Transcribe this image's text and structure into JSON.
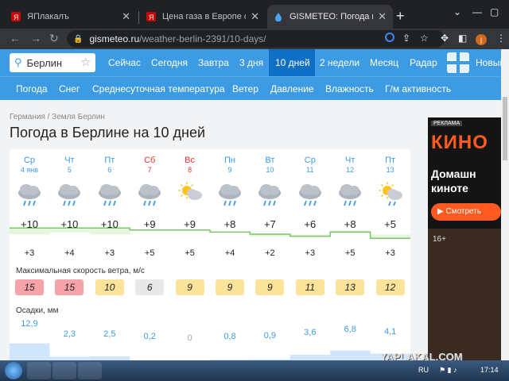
{
  "browser": {
    "tabs": [
      {
        "title": "ЯПлакалъ",
        "active": false
      },
      {
        "title": "Цена газа в Европе опустилась",
        "active": false
      },
      {
        "title": "GISMETEO: Погода в Берлине на",
        "active": true
      }
    ],
    "url_host": "gismeteo.ru",
    "url_path": "/weather-berlin-2391/10-days/",
    "avatar_letter": "j"
  },
  "site": {
    "search_value": "Берлин",
    "nav": [
      "Сейчас",
      "Сегодня",
      "Завтра",
      "3 дня",
      "10 дней",
      "2 недели",
      "Месяц",
      "Радар",
      "Новый"
    ],
    "active_nav": "10 дней",
    "subnav": [
      "Погода",
      "Снег",
      "Среднесуточная температура",
      "Ветер",
      "Давление",
      "Влажность",
      "Г/м активность"
    ],
    "breadcrumb": "Германия / Земля Берлин",
    "title": "Погода в Берлине на 10 дней",
    "wind_title": "Максимальная скорость ветра, м/с",
    "precip_title": "Осадки, мм",
    "days": [
      {
        "name": "Ср",
        "date": "4 янв",
        "weekend": false,
        "icon": "cloud-rain-icon",
        "tmax": "+10",
        "tmin": "+3",
        "wind": "15",
        "windcolor": "#f5a3a8",
        "precip": "12,9",
        "precip_level": 0.9
      },
      {
        "name": "Чт",
        "date": "5",
        "weekend": false,
        "icon": "cloud-rain-icon",
        "tmax": "+10",
        "tmin": "+4",
        "wind": "15",
        "windcolor": "#f5a3a8",
        "precip": "2,3",
        "precip_level": 0.25
      },
      {
        "name": "Пт",
        "date": "6",
        "weekend": false,
        "icon": "cloud-rain-icon",
        "tmax": "+10",
        "tmin": "+3",
        "wind": "10",
        "windcolor": "#fbe39a",
        "precip": "2,5",
        "precip_level": 0.27
      },
      {
        "name": "Сб",
        "date": "7",
        "weekend": true,
        "icon": "cloud-rain-icon",
        "tmax": "+9",
        "tmin": "+5",
        "wind": "6",
        "windcolor": "#e8e8e8",
        "precip": "0,2",
        "precip_level": 0.08
      },
      {
        "name": "Вс",
        "date": "8",
        "weekend": true,
        "icon": "sun-cloud-icon",
        "tmax": "+9",
        "tmin": "+5",
        "wind": "9",
        "windcolor": "#fbe39a",
        "precip": "0",
        "precip_level": 0
      },
      {
        "name": "Пн",
        "date": "9",
        "weekend": false,
        "icon": "cloud-rain-icon",
        "tmax": "+8",
        "tmin": "+4",
        "wind": "9",
        "windcolor": "#fbe39a",
        "precip": "0,8",
        "precip_level": 0.12
      },
      {
        "name": "Вт",
        "date": "10",
        "weekend": false,
        "icon": "cloud-rain-icon",
        "tmax": "+7",
        "tmin": "+2",
        "wind": "9",
        "windcolor": "#fbe39a",
        "precip": "0,9",
        "precip_level": 0.13
      },
      {
        "name": "Ср",
        "date": "11",
        "weekend": false,
        "icon": "cloud-rain-icon",
        "tmax": "+6",
        "tmin": "+3",
        "wind": "11",
        "windcolor": "#fbe39a",
        "precip": "3,6",
        "precip_level": 0.35
      },
      {
        "name": "Чт",
        "date": "12",
        "weekend": false,
        "icon": "cloud-rain-icon",
        "tmax": "+8",
        "tmin": "+5",
        "wind": "13",
        "windcolor": "#fbe39a",
        "precip": "6,8",
        "precip_level": 0.55
      },
      {
        "name": "Пт",
        "date": "13",
        "weekend": false,
        "icon": "sun-cloud-rain-icon",
        "tmax": "+5",
        "tmin": "+3",
        "wind": "12",
        "windcolor": "#fbe39a",
        "precip": "4,1",
        "precip_level": 0.4
      }
    ]
  },
  "ad": {
    "label": "РЕКЛАМА",
    "logo": "КИНО",
    "text": "Домашн\nкиноте",
    "button": "▶ Смотреть",
    "age": "16+"
  },
  "watermark": "YAPLAKAL.COM",
  "taskbar": {
    "lang": "RU",
    "time": "17:14"
  }
}
